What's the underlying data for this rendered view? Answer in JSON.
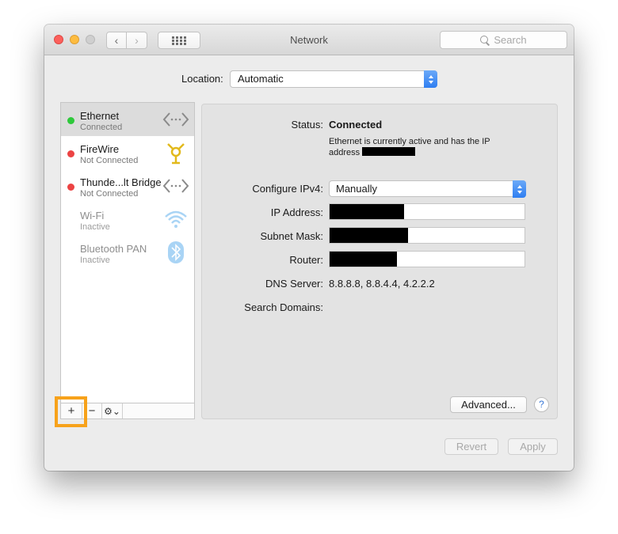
{
  "window": {
    "title": "Network",
    "search_placeholder": "Search",
    "nav_back_glyph": "‹",
    "nav_forward_glyph": "›"
  },
  "location": {
    "label": "Location:",
    "value": "Automatic"
  },
  "services": [
    {
      "name": "Ethernet",
      "status": "Connected",
      "indicator": "green",
      "icon": "ethernet-icon",
      "selected": true
    },
    {
      "name": "FireWire",
      "status": "Not Connected",
      "indicator": "red",
      "icon": "firewire-icon"
    },
    {
      "name": "Thunde...lt Bridge",
      "status": "Not Connected",
      "indicator": "red",
      "icon": "thunderbolt-bridge-icon"
    },
    {
      "name": "Wi-Fi",
      "status": "Inactive",
      "indicator": "none",
      "icon": "wifi-icon"
    },
    {
      "name": "Bluetooth PAN",
      "status": "Inactive",
      "indicator": "none",
      "icon": "bluetooth-icon"
    }
  ],
  "sidebar_toolbar": {
    "add_glyph": "+",
    "remove_glyph": "−",
    "gear_glyph": "⚙⌄"
  },
  "details": {
    "status_label": "Status:",
    "status_value": "Connected",
    "status_description": "Ethernet is currently active and has the IP address",
    "configure_label": "Configure IPv4:",
    "configure_value": "Manually",
    "ip_label": "IP Address:",
    "subnet_label": "Subnet Mask:",
    "router_label": "Router:",
    "dns_label": "DNS Server:",
    "dns_value": "8.8.8.8, 8.8.4.4, 4.2.2.2",
    "search_domains_label": "Search Domains:",
    "advanced_button": "Advanced...",
    "help_glyph": "?"
  },
  "footer": {
    "revert_button": "Revert",
    "apply_button": "Apply"
  },
  "colors": {
    "status_green": "#2ec93b",
    "status_red": "#ec4343",
    "accent_blue": "#2f7ef1",
    "highlight_orange": "#f7a21b"
  }
}
